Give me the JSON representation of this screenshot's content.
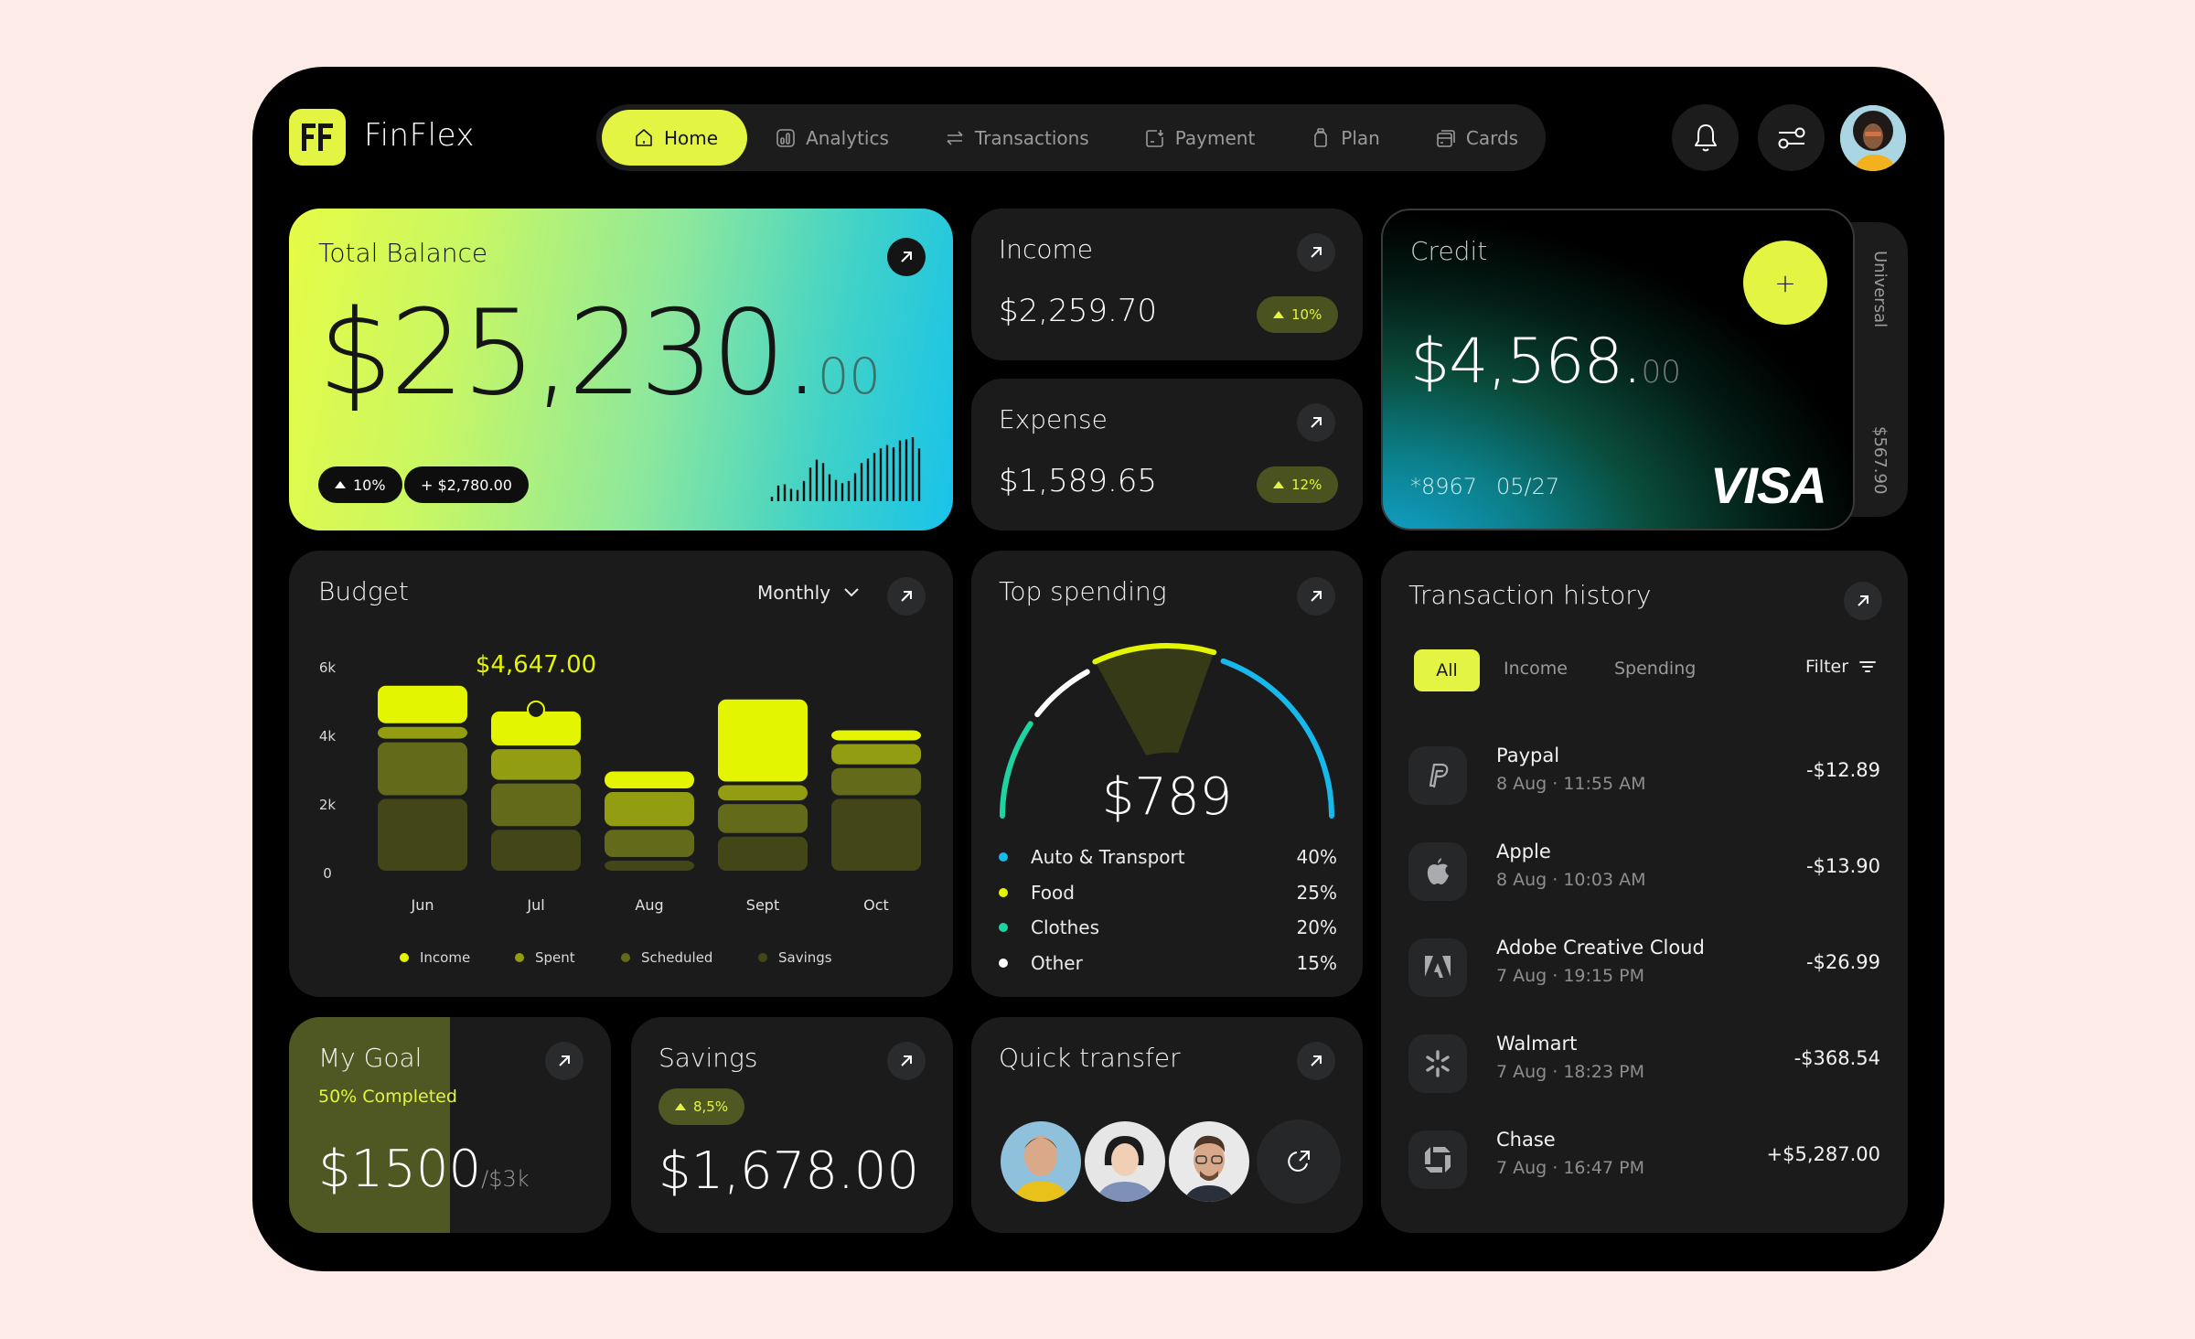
{
  "app": {
    "name": "FinFlex",
    "logo_text": "FF"
  },
  "nav": {
    "items": [
      {
        "label": "Home",
        "icon": "home-icon",
        "active": true
      },
      {
        "label": "Analytics",
        "icon": "analytics-icon",
        "active": false
      },
      {
        "label": "Transactions",
        "icon": "transfer-arrows-icon",
        "active": false
      },
      {
        "label": "Payment",
        "icon": "payment-icon",
        "active": false
      },
      {
        "label": "Plan",
        "icon": "jar-icon",
        "active": false
      },
      {
        "label": "Cards",
        "icon": "cards-icon",
        "active": false
      }
    ]
  },
  "header_actions": {
    "notifications_icon": "bell-icon",
    "settings_icon": "sliders-icon",
    "avatar": "user-avatar"
  },
  "colors": {
    "accent": "#e3f542",
    "blue": "#17b8ea",
    "teal": "#1fd3a0",
    "white": "#ffffff",
    "card_bg": "#1b1b1b"
  },
  "total_balance": {
    "title": "Total Balance",
    "amount_main": "$25,230.",
    "amount_cents": "00",
    "change_pct": "10%",
    "change_amount": "+ $2,780.00",
    "sparkline": [
      4,
      14,
      15,
      11,
      10,
      18,
      30,
      37,
      34,
      24,
      19,
      16,
      18,
      25,
      34,
      38,
      43,
      47,
      50,
      48,
      54,
      55,
      57,
      47
    ]
  },
  "income": {
    "title": "Income",
    "amount": "$2,259.70",
    "change": "10%"
  },
  "expense": {
    "title": "Expense",
    "amount": "$1,589.65",
    "change": "12%"
  },
  "credit_card": {
    "title": "Credit",
    "amount_main": "$4,568.",
    "amount_cents": "00",
    "number": "*8967",
    "expiry": "05/27",
    "brand": "VISA",
    "add_label": "+",
    "secondary_card": {
      "name": "Universal",
      "amount": "$567.90"
    }
  },
  "budget": {
    "title": "Budget",
    "period": "Monthly",
    "highlight_value": "$4,647.00"
  },
  "chart_data": {
    "type": "bar",
    "stacked": true,
    "title": "Budget",
    "categories": [
      "Jun",
      "Jul",
      "Aug",
      "Sept",
      "Oct"
    ],
    "yticks": [
      "0",
      "2k",
      "4k",
      "6k"
    ],
    "ylim": [
      0,
      6000
    ],
    "series": [
      {
        "name": "Savings",
        "color": "#434717",
        "values": [
          2200,
          1300,
          400,
          1100,
          2200
        ]
      },
      {
        "name": "Scheduled",
        "color": "#636b1a",
        "values": [
          1650,
          1350,
          900,
          950,
          900
        ]
      },
      {
        "name": "Spent",
        "color": "#939d12",
        "values": [
          450,
          1000,
          1100,
          550,
          700
        ]
      },
      {
        "name": "Income",
        "color": "#e3f500",
        "values": [
          1200,
          1100,
          600,
          2500,
          400
        ]
      }
    ],
    "annotation": {
      "category": "Jul",
      "label": "$4,647.00"
    },
    "legend": [
      "Income",
      "Spent",
      "Scheduled",
      "Savings"
    ],
    "legend_position": "bottom"
  },
  "top_spending": {
    "title": "Top spending",
    "total": "$789",
    "categories": [
      {
        "label": "Auto & Transport",
        "pct": "40%",
        "value": 40,
        "color": "#17b8ea"
      },
      {
        "label": "Food",
        "pct": "25%",
        "value": 25,
        "color": "#e3f500"
      },
      {
        "label": "Clothes",
        "pct": "20%",
        "value": 20,
        "color": "#1fd3a0"
      },
      {
        "label": "Other",
        "pct": "15%",
        "value": 15,
        "color": "#ffffff"
      }
    ]
  },
  "transactions": {
    "title": "Transaction history",
    "tabs": [
      "All",
      "Income",
      "Spending"
    ],
    "active_tab": "All",
    "filter_label": "Filter",
    "items": [
      {
        "name": "Paypal",
        "date": "8 Aug · 11:55 AM",
        "amount": "-$12.89",
        "icon": "paypal-icon"
      },
      {
        "name": "Apple",
        "date": "8 Aug · 10:03 AM",
        "amount": "-$13.90",
        "icon": "apple-icon"
      },
      {
        "name": "Adobe Creative Cloud",
        "date": "7 Aug · 19:15 PM",
        "amount": "-$26.99",
        "icon": "adobe-icon"
      },
      {
        "name": "Walmart",
        "date": "7 Aug · 18:23 PM",
        "amount": "-$368.54",
        "icon": "walmart-icon"
      },
      {
        "name": "Chase",
        "date": "7 Aug · 16:47 PM",
        "amount": "+$5,287.00",
        "icon": "chase-icon"
      }
    ]
  },
  "goal": {
    "title": "My Goal",
    "completed_label": "50% Completed",
    "progress": 0.5,
    "amount": "$1500",
    "target": "/$3k"
  },
  "savings": {
    "title": "Savings",
    "change": "8,5%",
    "amount": "$1,678.00"
  },
  "quick_transfer": {
    "title": "Quick transfer",
    "contacts": [
      "contact-avatar-1",
      "contact-avatar-2",
      "contact-avatar-3"
    ],
    "more_icon": "share-arrow-icon"
  }
}
